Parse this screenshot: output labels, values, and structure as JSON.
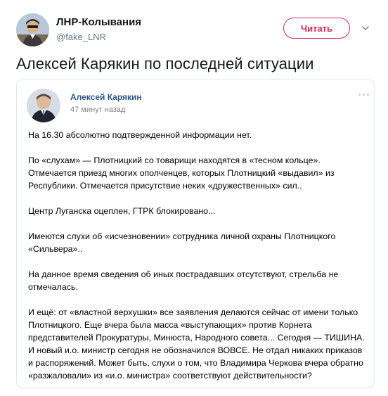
{
  "tweet": {
    "author_name": "ЛНР-Колывания",
    "author_handle": "@fake_LNR",
    "follow_label": "Читать",
    "text": "Алексей Карякин по последней ситуации"
  },
  "post": {
    "author": "Алексей Карякин",
    "time": "47 минут назад",
    "paragraphs": [
      "На 16.30 абсолютно подтвержденной информации нет.",
      "По «слухам» — Плотницкий со товарищи находятся в «тесном кольце».\nОтмечается приезд многих ополченцев, которых Плотницкий «выдавил» из\nРеспублики. Отмечается присутствие неких «дружественных» сил..",
      "Центр Луганска оцеплен, ГТРК блокировано...",
      "Имеются слухи об «исчезновении» сотрудника личной охраны Плотницкого\n«Сильвера»..",
      "На данное время сведения об иных пострадавших отсутствуют, стрельба не\nотмечалась.",
      "И ещё: от «властной верхушки» все заявления делаются сейчас от имени только\nПлотницкого. Еще вчера была масса «выступающих» против Корнета\nпредставителей Прокуратуры, Минюста, Народного совета... Сегодня — ТИШИНА.\nИ новый и.о. министр сегодня не обозначился ВОВСЕ. Не отдал никаких приказов\nи распоряжений. Может быть, слухи о том, что Владимира Черкова вчера обратно\n«разжаловали» из «и.о. министра» соответствуют действительности?"
    ]
  },
  "icons": {
    "chevron": "chevron-down-icon",
    "more": "more-dots-icon"
  },
  "colors": {
    "accent": "#e0245e",
    "vk_link": "#2a5885",
    "muted": "#657786"
  }
}
